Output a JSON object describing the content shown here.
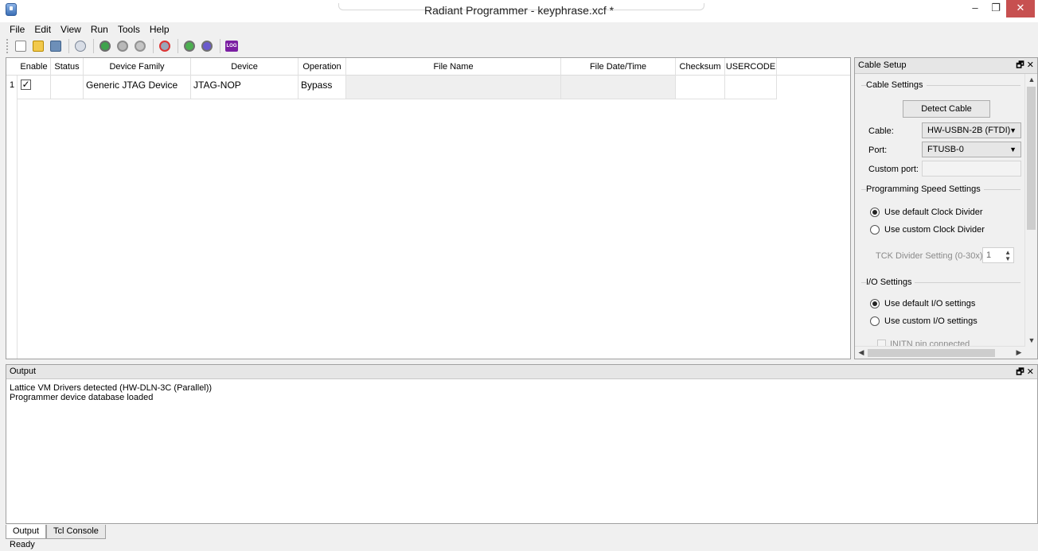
{
  "window": {
    "title": "Radiant Programmer - keyphrase.xcf *",
    "min_glyph": "–",
    "max_glyph": "❐",
    "close_glyph": "✕"
  },
  "menu": [
    "File",
    "Edit",
    "View",
    "Run",
    "Tools",
    "Help"
  ],
  "toolbar": {
    "icons": [
      "new-project-icon",
      "open-project-icon",
      "save-icon",
      "scan-chain-icon",
      "program-icon",
      "verify-icon",
      "erase-icon",
      "device-info-icon",
      "download-icon",
      "upload-icon",
      "log-icon"
    ],
    "log_label": "LOG"
  },
  "grid": {
    "columns": [
      "Enable",
      "Status",
      "Device Family",
      "Device",
      "Operation",
      "File Name",
      "File Date/Time",
      "Checksum",
      "USERCODE"
    ],
    "rows": [
      {
        "num": "1",
        "enable_mark": "✓",
        "status": "",
        "device_family": "Generic JTAG Device",
        "device": "JTAG-NOP",
        "operation": "Bypass",
        "file_name": "",
        "file_datetime": "",
        "checksum": "",
        "usercode": ""
      }
    ]
  },
  "cable_setup": {
    "title": "Cable Setup",
    "controls": "🗗 ✕",
    "cable_settings_title": "Cable Settings",
    "detect_button": "Detect Cable",
    "cable_label": "Cable:",
    "cable_value": "HW-USBN-2B (FTDI)",
    "port_label": "Port:",
    "port_value": "FTUSB-0",
    "custom_port_label": "Custom port:",
    "speed_title": "Programming Speed Settings",
    "speed_default": "Use default Clock Divider",
    "speed_custom": "Use custom Clock Divider",
    "tck_label": "TCK Divider Setting (0-30x):",
    "tck_value": "1",
    "io_title": "I/O Settings",
    "io_default": "Use default I/O settings",
    "io_custom": "Use custom I/O settings",
    "initn_label": "INITN pin connected"
  },
  "output": {
    "title": "Output",
    "controls": "🗗 ✕",
    "lines": [
      "Lattice VM Drivers detected (HW-DLN-3C (Parallel))",
      "Programmer device database loaded"
    ]
  },
  "tabs": [
    "Output",
    "Tcl Console"
  ],
  "status": "Ready"
}
